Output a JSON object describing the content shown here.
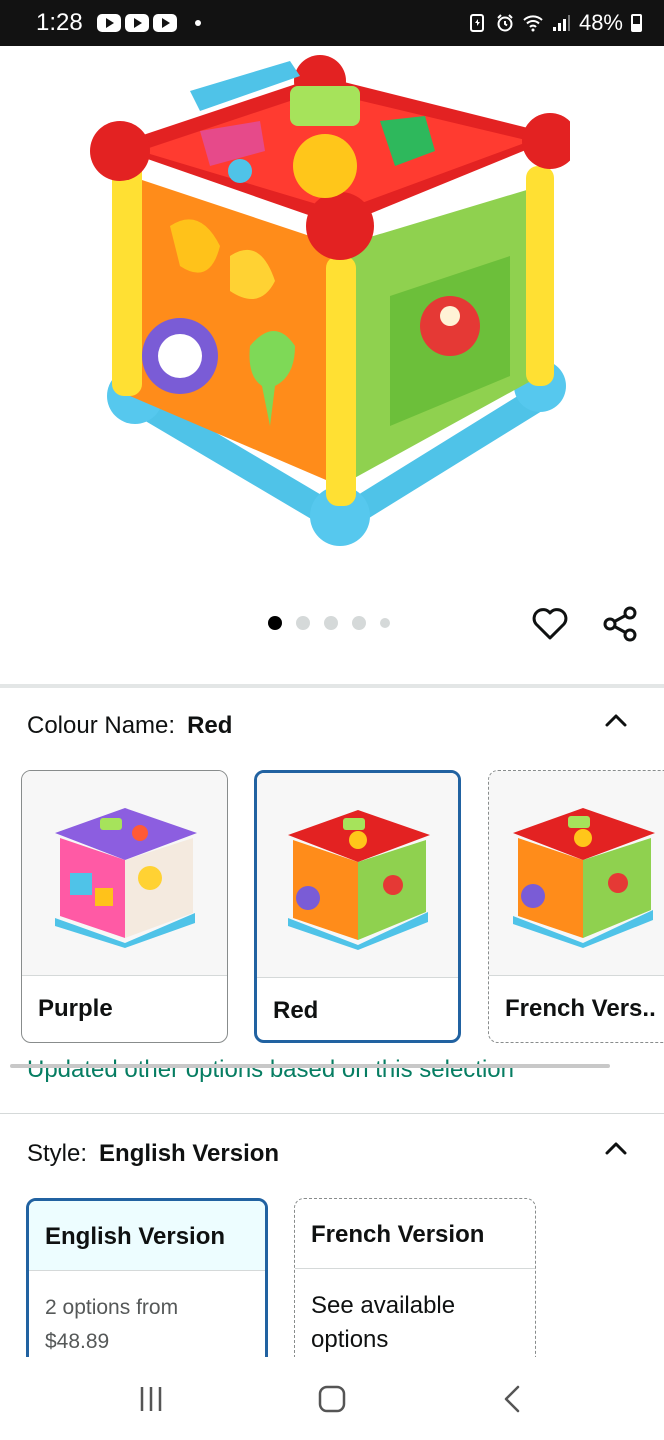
{
  "status_bar": {
    "time": "1:28",
    "battery": "48%"
  },
  "gallery": {
    "image_count": 5,
    "active_index": 0
  },
  "colour": {
    "label": "Colour Name:",
    "selected": "Red",
    "options": [
      {
        "label": "Purple"
      },
      {
        "label": "Red"
      },
      {
        "label": "French Vers.."
      }
    ],
    "update_message": "Updated other options based on this selection"
  },
  "style": {
    "label": "Style:",
    "selected": "English Version",
    "options": [
      {
        "title": "English Version",
        "line1": "2 options from",
        "line2": "$48.89"
      },
      {
        "title": "French Version",
        "line1": "See available",
        "line2": "options"
      }
    ]
  },
  "colors": {
    "accent_blue": "#2162a1",
    "green_text": "#067d62"
  }
}
